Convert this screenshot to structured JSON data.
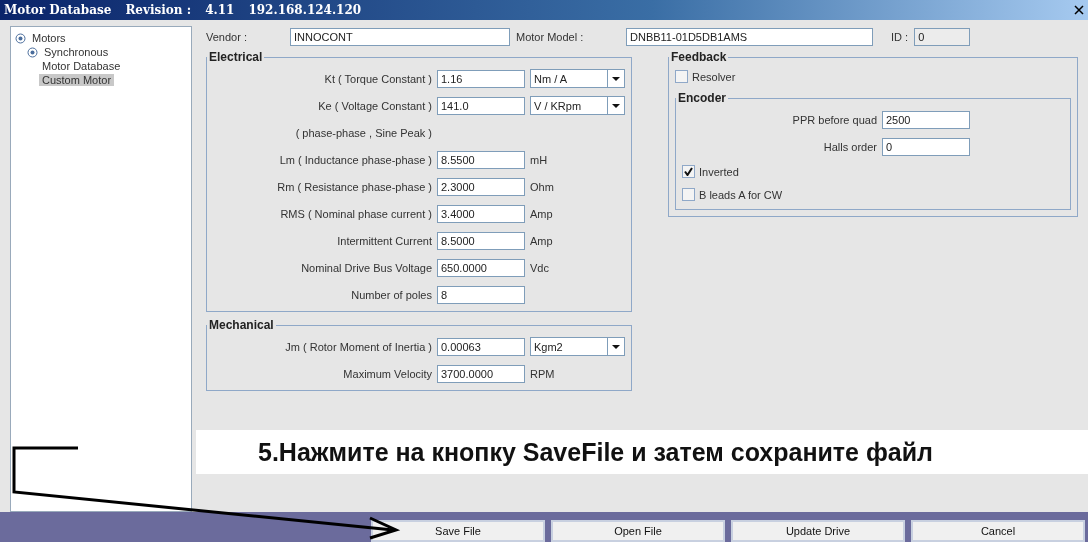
{
  "window": {
    "title": "Motor Database",
    "revision_label": "Revision :",
    "revision": "4.11",
    "address": "192.168.124.120"
  },
  "tree": [
    {
      "label": "Motors",
      "selected": false,
      "children": [
        {
          "label": "Synchronous",
          "selected": false,
          "children": [
            {
              "label": "Motor Database",
              "selected": false
            },
            {
              "label": "Custom Motor",
              "selected": true
            }
          ]
        }
      ]
    }
  ],
  "vendor": {
    "label": "Vendor :",
    "value": "INNOCONT"
  },
  "motor_model": {
    "label": "Motor Model :",
    "value": "DNBB11-01D5DB1AMS"
  },
  "id": {
    "label": "ID :",
    "value": "0"
  },
  "electrical": {
    "title": "Electrical",
    "rows": [
      {
        "kind": "field",
        "label": "Kt ( Torque Constant )",
        "value": "1.16",
        "unit": {
          "kind": "dropdown",
          "label": "Nm / A"
        }
      },
      {
        "kind": "field",
        "label": "Ke ( Voltage Constant )",
        "value": "141.0",
        "unit": {
          "kind": "dropdown",
          "label": "V / KRpm"
        }
      },
      {
        "kind": "note",
        "label": "( phase-phase , Sine Peak )"
      },
      {
        "kind": "field",
        "label": "Lm ( Inductance phase-phase )",
        "value": "8.5500",
        "unit": {
          "kind": "text",
          "label": "mH"
        }
      },
      {
        "kind": "field",
        "label": "Rm ( Resistance phase-phase )",
        "value": "2.3000",
        "unit": {
          "kind": "text",
          "label": "Ohm"
        }
      },
      {
        "kind": "field",
        "label": "RMS ( Nominal phase current )",
        "value": "3.4000",
        "unit": {
          "kind": "text",
          "label": "Amp"
        }
      },
      {
        "kind": "field",
        "label": "Intermittent Current",
        "value": "8.5000",
        "unit": {
          "kind": "text",
          "label": "Amp"
        }
      },
      {
        "kind": "field",
        "label": "Nominal Drive Bus Voltage",
        "value": "650.0000",
        "unit": {
          "kind": "text",
          "label": "Vdc"
        }
      },
      {
        "kind": "field",
        "label": "Number of poles",
        "value": "8"
      }
    ]
  },
  "mechanical": {
    "title": "Mechanical",
    "rows": [
      {
        "kind": "field",
        "label": "Jm ( Rotor Moment of Inertia )",
        "value": "0.00063",
        "unit": {
          "kind": "dropdown",
          "label": "Kgm2"
        }
      },
      {
        "kind": "field",
        "label": "Maximum Velocity",
        "value": "3700.0000",
        "unit": {
          "kind": "text",
          "label": "RPM"
        }
      }
    ]
  },
  "feedback": {
    "title": "Feedback",
    "resolver": {
      "label": "Resolver",
      "checked": false
    },
    "encoder": {
      "title": "Encoder",
      "fields": [
        {
          "label": "PPR before quad",
          "value": "2500"
        },
        {
          "label": "Halls order",
          "value": "0"
        }
      ],
      "checks": [
        {
          "label": "Inverted",
          "checked": true
        },
        {
          "label": "B leads A for CW",
          "checked": false
        }
      ]
    }
  },
  "annotation": "5.Нажмите на кнопку SaveFile и затем сохраните файл",
  "buttons": [
    "Save File",
    "Open File",
    "Update Drive",
    "Cancel"
  ]
}
